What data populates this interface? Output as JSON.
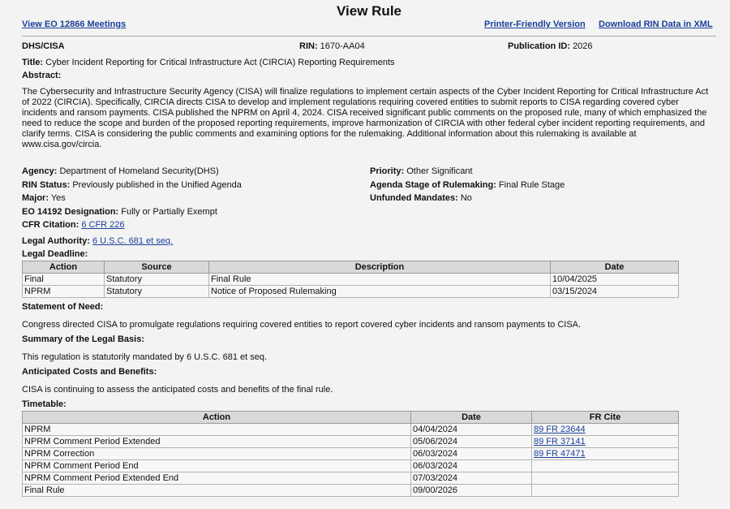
{
  "header": {
    "title": "View Rule",
    "left_link": "View EO 12866 Meetings",
    "print_link": "Printer-Friendly Version",
    "xml_link": "Download RIN Data in XML"
  },
  "ids": {
    "agency_code": "DHS/CISA",
    "rin_label": "RIN:",
    "rin": "1670-AA04",
    "pubid_label": "Publication ID:",
    "pubid": "2026"
  },
  "rule": {
    "title_label": "Title:",
    "title": "Cyber Incident Reporting for Critical Infrastructure Act (CIRCIA) Reporting Requirements",
    "abstract_label": "Abstract:",
    "abstract": "The Cybersecurity and Infrastructure Security Agency (CISA) will finalize regulations to implement certain aspects of the Cyber Incident Reporting for Critical Infrastructure Act of 2022 (CIRCIA).  Specifically, CIRCIA directs CISA to develop and implement regulations requiring covered entities to submit reports to CISA regarding covered cyber incidents and ransom payments.  CISA published the NPRM on April 4, 2024. CISA received significant public comments on the proposed rule, many of which emphasized the need to reduce the scope and burden of the proposed reporting requirements, improve harmonization of CIRCIA with other federal cyber incident reporting requirements, and clarify terms. CISA is considering the public comments and examining options for the rulemaking. Additional information about this rulemaking is available at www.cisa.gov/circia."
  },
  "details": {
    "agency_label": "Agency:",
    "agency": "Department of Homeland Security(DHS)",
    "rin_status_label": "RIN Status:",
    "rin_status": "Previously published in the Unified Agenda",
    "major_label": "Major:",
    "major": "Yes",
    "eo_label": "EO 14192 Designation:",
    "eo": "Fully or Partially Exempt",
    "cfr_label": "CFR Citation:",
    "cfr": "6 CFR 226",
    "authority_label": "Legal Authority:",
    "authority": "6 U.S.C. 681 et seq.",
    "priority_label": "Priority:",
    "priority": "Other Significant",
    "stage_label": "Agenda Stage of Rulemaking:",
    "stage": "Final Rule Stage",
    "unfunded_label": "Unfunded Mandates:",
    "unfunded": "No"
  },
  "deadline": {
    "label": "Legal Deadline:",
    "headers": [
      "Action",
      "Source",
      "Description",
      "Date"
    ],
    "rows": [
      [
        "Final",
        "Statutory",
        "Final Rule",
        "10/04/2025"
      ],
      [
        "NPRM",
        "Statutory",
        "Notice of Proposed Rulemaking",
        "03/15/2024"
      ]
    ]
  },
  "sections": {
    "need_label": "Statement of Need:",
    "need": "Congress directed CISA to promulgate regulations requiring covered entities to report covered cyber incidents and ransom payments to CISA.",
    "basis_label": "Summary of the Legal Basis:",
    "basis": "This regulation is statutorily mandated by 6 U.S.C. 681 et seq.",
    "costs_label": "Anticipated Costs and Benefits:",
    "costs": "CISA is continuing to assess the anticipated costs and benefits of the final rule."
  },
  "timetable": {
    "label": "Timetable:",
    "headers": [
      "Action",
      "Date",
      "FR Cite"
    ],
    "rows": [
      [
        "NPRM",
        "04/04/2024",
        "89 FR 23644"
      ],
      [
        "NPRM Comment Period Extended",
        "05/06/2024",
        "89 FR 37141"
      ],
      [
        "NPRM Correction",
        "06/03/2024",
        "89 FR 47471"
      ],
      [
        "NPRM Comment Period End",
        "06/03/2024",
        ""
      ],
      [
        "NPRM Comment Period Extended End",
        "07/03/2024",
        ""
      ],
      [
        "Final Rule",
        "09/00/2026",
        ""
      ]
    ]
  }
}
